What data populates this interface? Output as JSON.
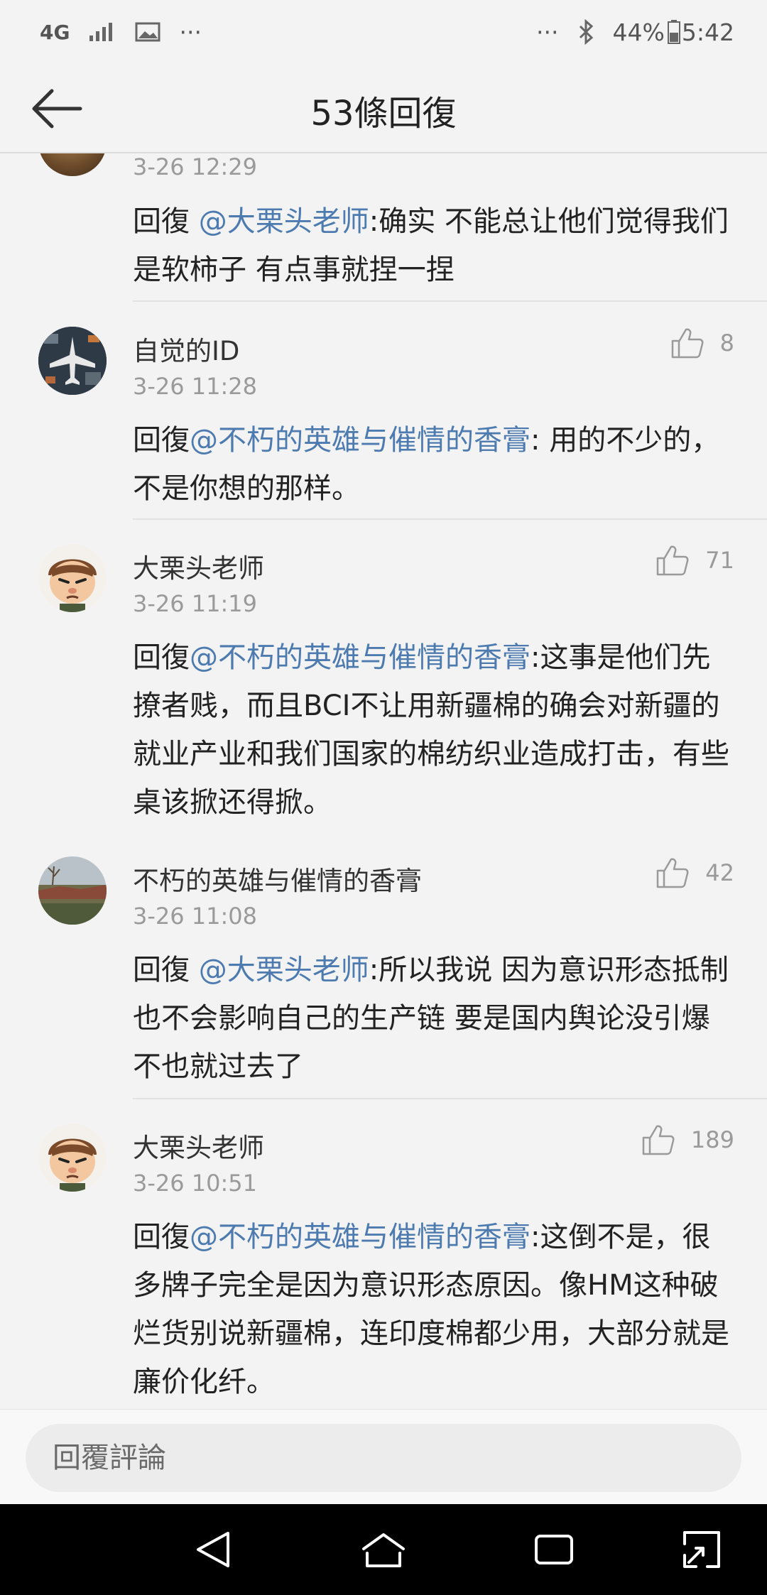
{
  "status_bar": {
    "network": "4G",
    "more": "···",
    "more_right": "···",
    "battery": "44%",
    "time": "5:42"
  },
  "header": {
    "title": "53條回復"
  },
  "comments": [
    {
      "name": "",
      "time": "3-26 12:29",
      "reply_prefix": "回復 ",
      "mention": "@大栗头老师",
      "text": ":确实  不能总让他们觉得我们是软柿子   有点事就捏一捏",
      "likes": ""
    },
    {
      "name": "自觉的ID",
      "time": "3-26 11:28",
      "reply_prefix": "回復",
      "mention": "@不朽的英雄与催情的香膏",
      "text": ": 用的不少的，不是你想的那样。",
      "likes": "8"
    },
    {
      "name": "大栗头老师",
      "time": "3-26 11:19",
      "reply_prefix": "回復",
      "mention": "@不朽的英雄与催情的香膏",
      "text": ":这事是他们先撩者贱，而且BCI不让用新疆棉的确会对新疆的就业产业和我们国家的棉纺织业造成打击，有些桌该掀还得掀。",
      "likes": "71"
    },
    {
      "name": "不朽的英雄与催情的香膏",
      "time": "3-26 11:08",
      "reply_prefix": "回復 ",
      "mention": "@大栗头老师",
      "text": ":所以我说   因为意识形态抵制  也不会影响自己的生产链   要是国内舆论没引爆   不也就过去了",
      "likes": "42"
    },
    {
      "name": "大栗头老师",
      "time": "3-26 10:51",
      "reply_prefix": "回復",
      "mention": "@不朽的英雄与催情的香膏",
      "text": ":这倒不是，很多牌子完全是因为意识形态原因。像HM这种破烂货别说新疆棉，连印度棉都少用，大部分就是廉价化纤。",
      "likes": "189"
    }
  ],
  "reply_bar": {
    "placeholder": "回覆評論"
  },
  "colors": {
    "mention": "#4d7bb0",
    "background": "#f3f3f3",
    "nav": "#000000"
  }
}
